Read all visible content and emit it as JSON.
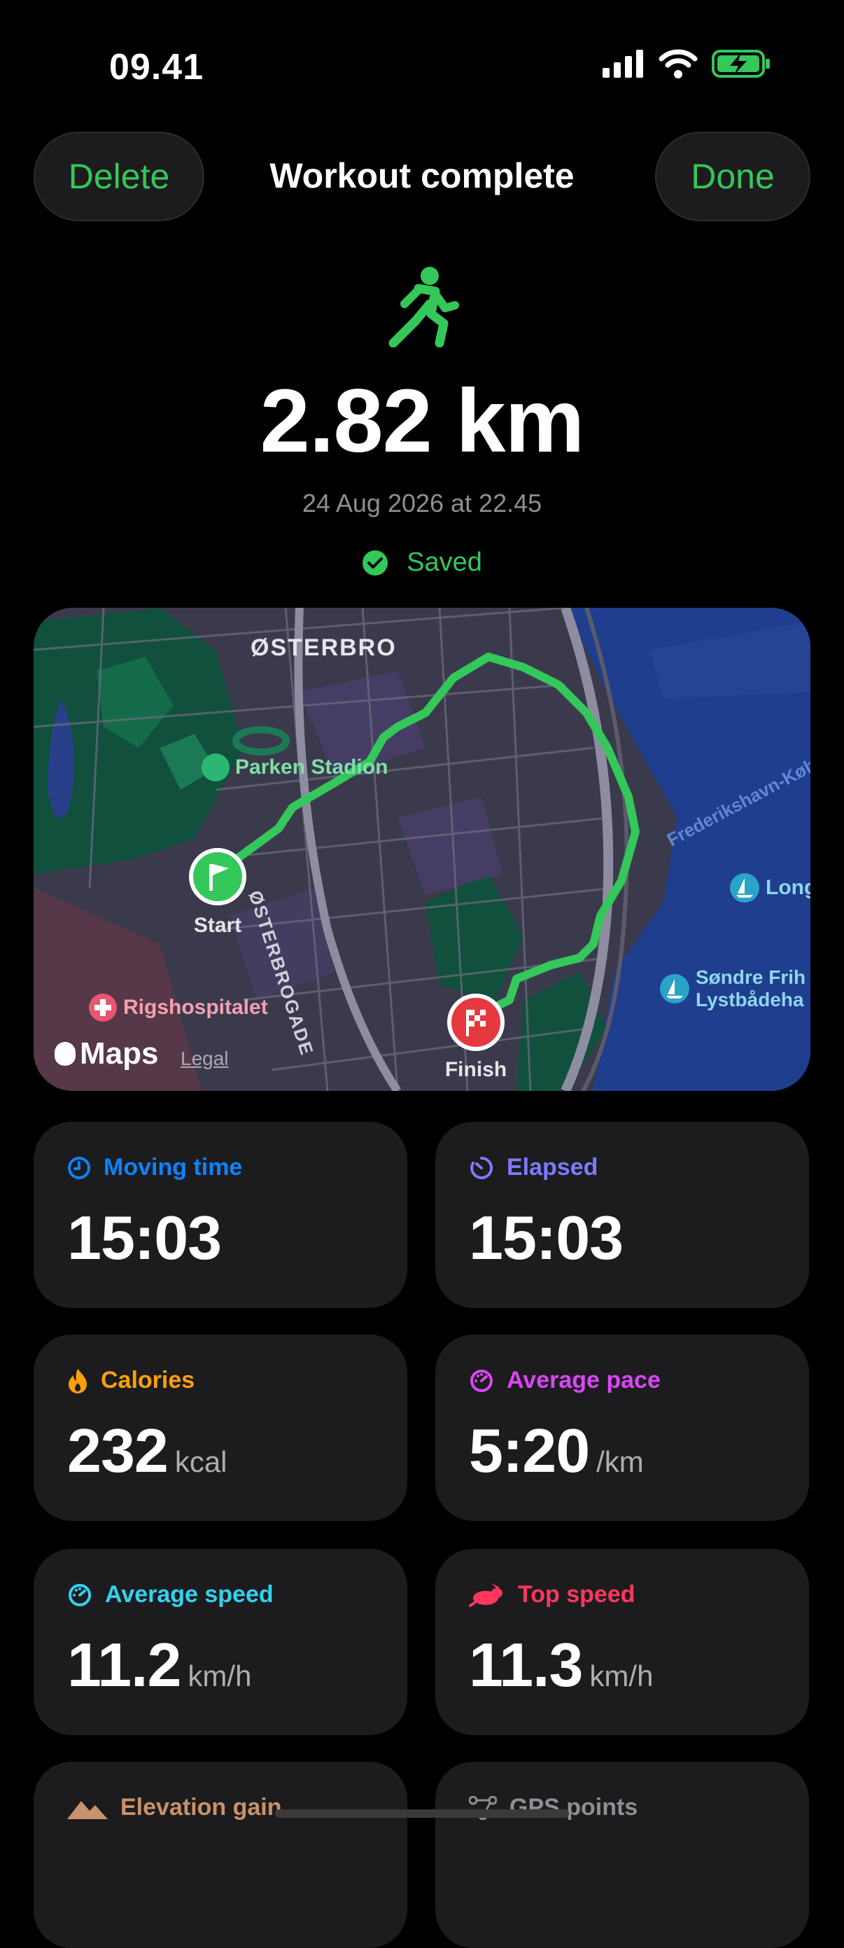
{
  "status_bar": {
    "time": "09.41",
    "icons": [
      "signal-icon",
      "wifi-icon",
      "battery-charging-icon"
    ]
  },
  "header": {
    "delete_label": "Delete",
    "title": "Workout complete",
    "done_label": "Done"
  },
  "summary": {
    "activity_icon": "running-icon",
    "distance": "2.82 km",
    "datetime": "24 Aug 2026 at 22.45",
    "saved_label": "Saved"
  },
  "map": {
    "labels": {
      "district": "ØSTERBRO",
      "stadium": "Parken Stadion",
      "street": "ØSTERBROGADE",
      "hospital": "Rigshospitalet",
      "waterway": "Frederikshavn-Københ",
      "place_1": "Long",
      "place_2a": "Søndre Frih",
      "place_2b": "Lystbådeha",
      "start": "Start",
      "finish": "Finish"
    },
    "maps_brand": "Maps",
    "legal": "Legal"
  },
  "stats": [
    {
      "label": "Moving time",
      "value": "15:03",
      "unit": "",
      "icon": "clock-icon",
      "color": "#0a84ff"
    },
    {
      "label": "Elapsed",
      "value": "15:03",
      "unit": "",
      "icon": "timer-icon",
      "color": "#7d7aff"
    },
    {
      "label": "Calories",
      "value": "232",
      "unit": "kcal",
      "icon": "flame-icon",
      "color": "#ff9f0a"
    },
    {
      "label": "Average pace",
      "value": "5:20",
      "unit": "/km",
      "icon": "gauge-icon",
      "color": "#da46f5"
    },
    {
      "label": "Average speed",
      "value": "11.2",
      "unit": "km/h",
      "icon": "speedometer-icon",
      "color": "#32d2f0"
    },
    {
      "label": "Top speed",
      "value": "11.3",
      "unit": "km/h",
      "icon": "hare-icon",
      "color": "#ff375f"
    },
    {
      "label": "Elevation gain",
      "value": "",
      "unit": "",
      "icon": "mountain-icon",
      "color": "#c9926a"
    },
    {
      "label": "GPS points",
      "value": "",
      "unit": "",
      "icon": "path-points-icon",
      "color": "#8e8e93"
    }
  ]
}
